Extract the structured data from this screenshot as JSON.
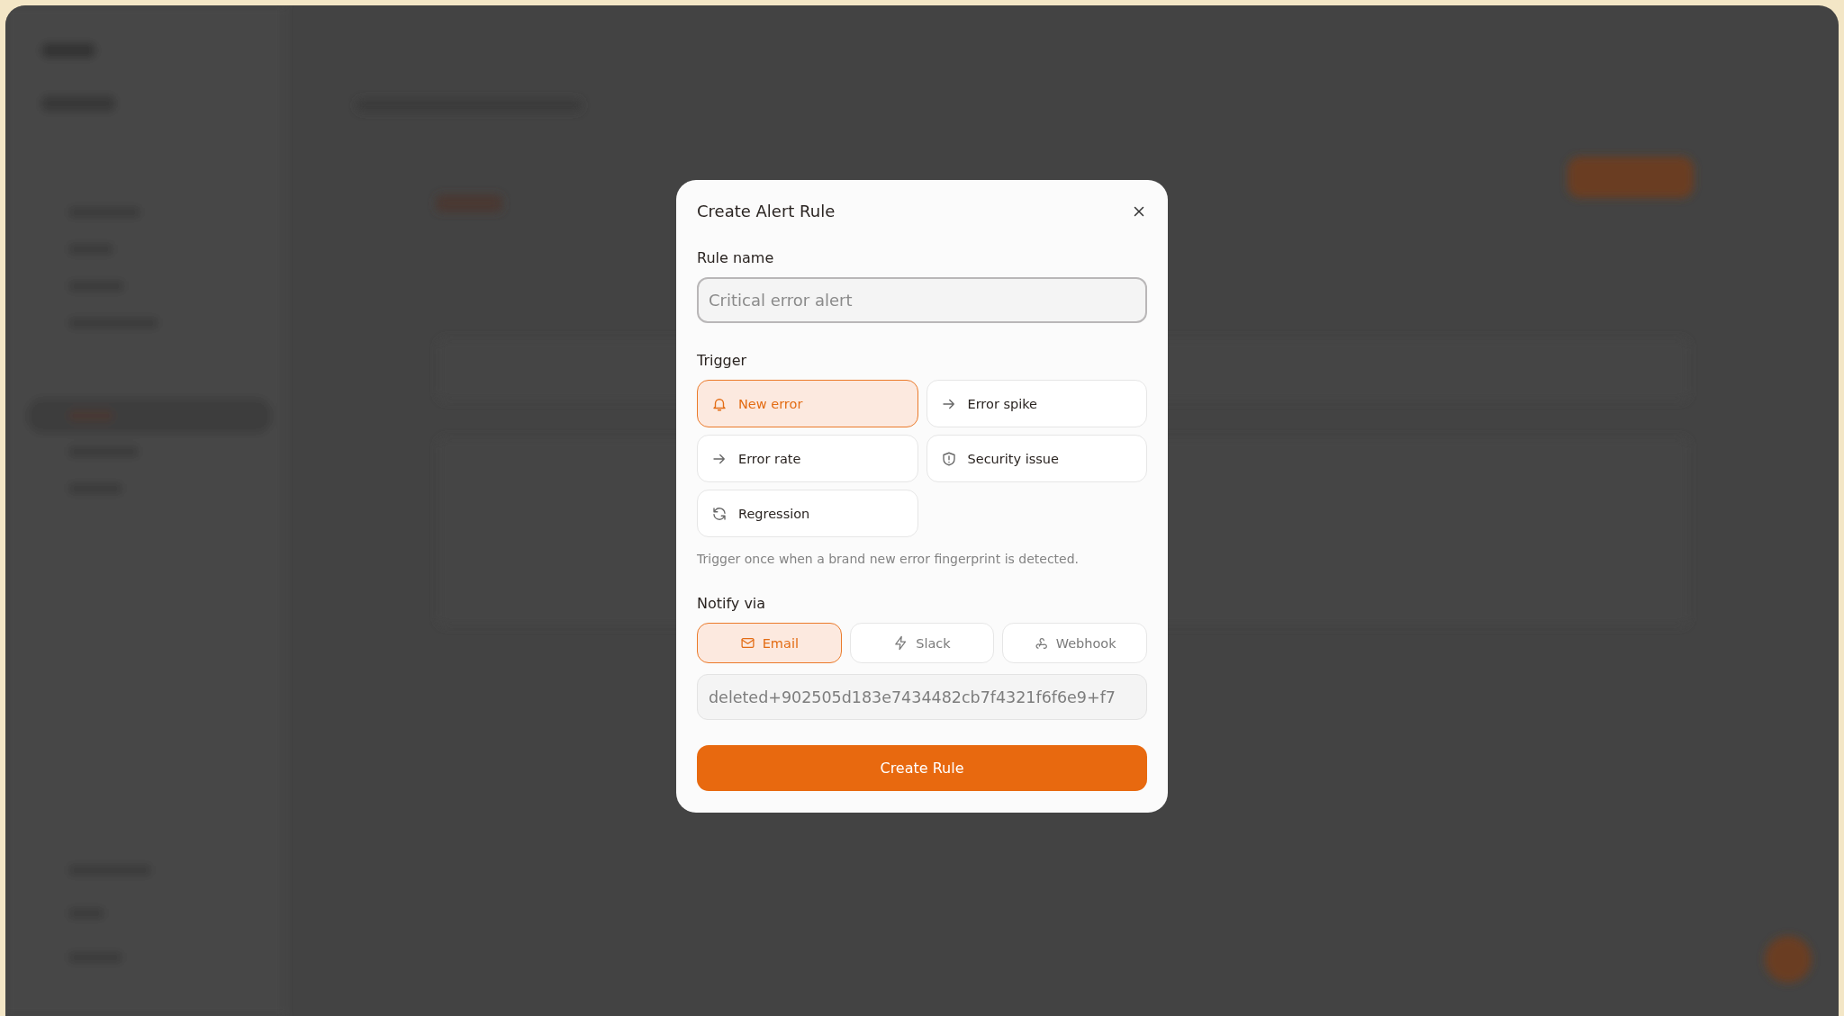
{
  "dialog": {
    "title": "Create Alert Rule",
    "rule_name": {
      "label": "Rule name",
      "placeholder": "Critical error alert"
    },
    "trigger": {
      "label": "Trigger",
      "options": [
        {
          "kind": "new",
          "label": "New error",
          "selected": true
        },
        {
          "kind": "spike",
          "label": "Error spike",
          "selected": false
        },
        {
          "kind": "rate",
          "label": "Error rate",
          "selected": false
        },
        {
          "kind": "security",
          "label": "Security issue",
          "selected": false
        },
        {
          "kind": "regression",
          "label": "Regression",
          "selected": false
        }
      ],
      "hint": "Trigger once when a brand new error fingerprint is detected."
    },
    "notify": {
      "label": "Notify via",
      "channels": [
        {
          "kind": "email",
          "label": "Email",
          "selected": true
        },
        {
          "kind": "slack",
          "label": "Slack",
          "selected": false
        },
        {
          "kind": "webhook",
          "label": "Webhook",
          "selected": false
        }
      ],
      "value": "deleted+902505d183e7434482cb7f4321f6f6e9+f7"
    },
    "submit": "Create Rule"
  }
}
